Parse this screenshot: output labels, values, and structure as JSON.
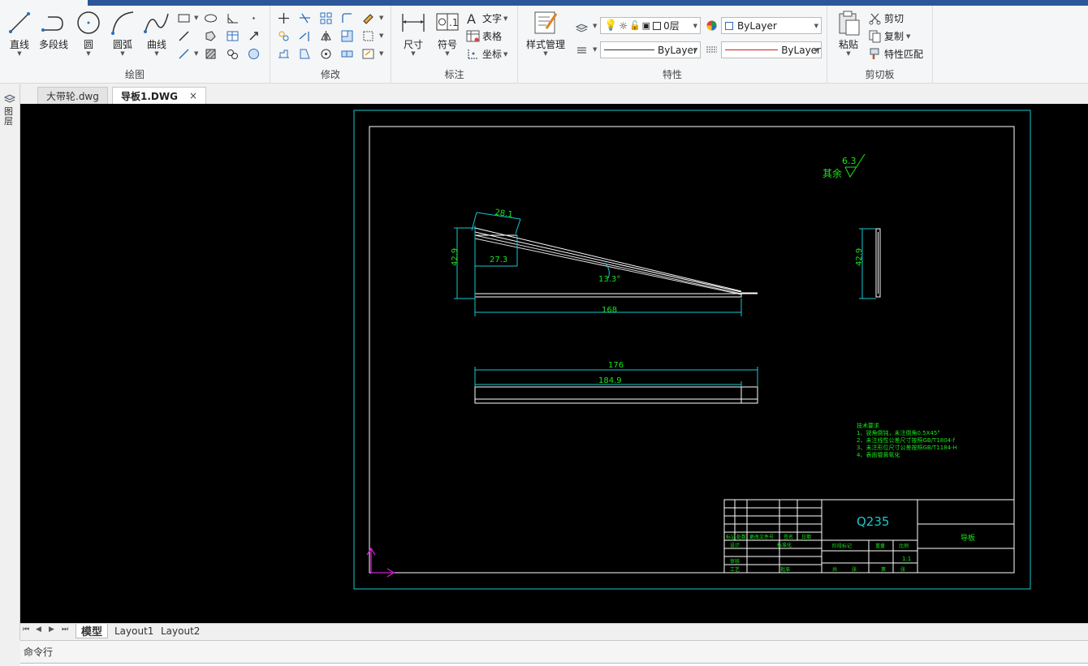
{
  "ribbon": {
    "draw": {
      "label": "绘图",
      "line": "直线",
      "polyline": "多段线",
      "circle": "圆",
      "arc": "圆弧",
      "spline": "曲线"
    },
    "modify": {
      "label": "修改"
    },
    "annotate": {
      "label": "标注",
      "dimension": "尺寸",
      "symbol": "符号",
      "text": "文字",
      "table": "表格",
      "coordinate": "坐标"
    },
    "properties": {
      "label": "特性",
      "style_manager": "样式管理",
      "layer_value": "0层",
      "color_value": "ByLayer",
      "linetype_value": "ByLayer",
      "lineweight_value": "ByLayer"
    },
    "clipboard": {
      "label": "剪切板",
      "paste": "粘贴",
      "cut": "剪切",
      "copy": "复制",
      "match_props": "特性匹配"
    }
  },
  "doc_tabs": [
    {
      "label": "大带轮.dwg",
      "active": false
    },
    {
      "label": "导板1.DWG",
      "active": true,
      "close": "×"
    }
  ],
  "left_strip": {
    "label": "图层"
  },
  "drawing": {
    "roughness_prefix": "其余",
    "roughness_value": "6.3",
    "dims": {
      "d_28_1": "28.1",
      "d_42_9_left": "42.9",
      "d_27_3": "27.3",
      "d_13_3": "13.3°",
      "d_168": "168",
      "d_42_9_right": "42.9",
      "d_176": "176",
      "d_184_9": "184.9"
    },
    "notes": [
      "技术要求",
      "1、锐角倒钝，未注倒角0.5X45°",
      "2、未注线性公差尺寸按照GB/T1804-f",
      "3、未注形位尺寸公差按照GB/T1184-H",
      "4、表面镀黄氧化"
    ],
    "title_block": {
      "material": "Q235",
      "part_name": "导板",
      "scale": "1:1",
      "row_labels": [
        "标记",
        "处数",
        "更改文件号",
        "签名",
        "日期"
      ],
      "design": "设计",
      "standardize": "标准化",
      "review": "审核",
      "process": "工艺",
      "approve": "批准",
      "stage_mark": "阶段标记",
      "weight": "重量",
      "ratio": "比例",
      "total": "共",
      "sheet": "张",
      "nth": "第"
    }
  },
  "layout_tabs": [
    "模型",
    "Layout1",
    "Layout2"
  ],
  "cmd": {
    "label": "命令行"
  }
}
